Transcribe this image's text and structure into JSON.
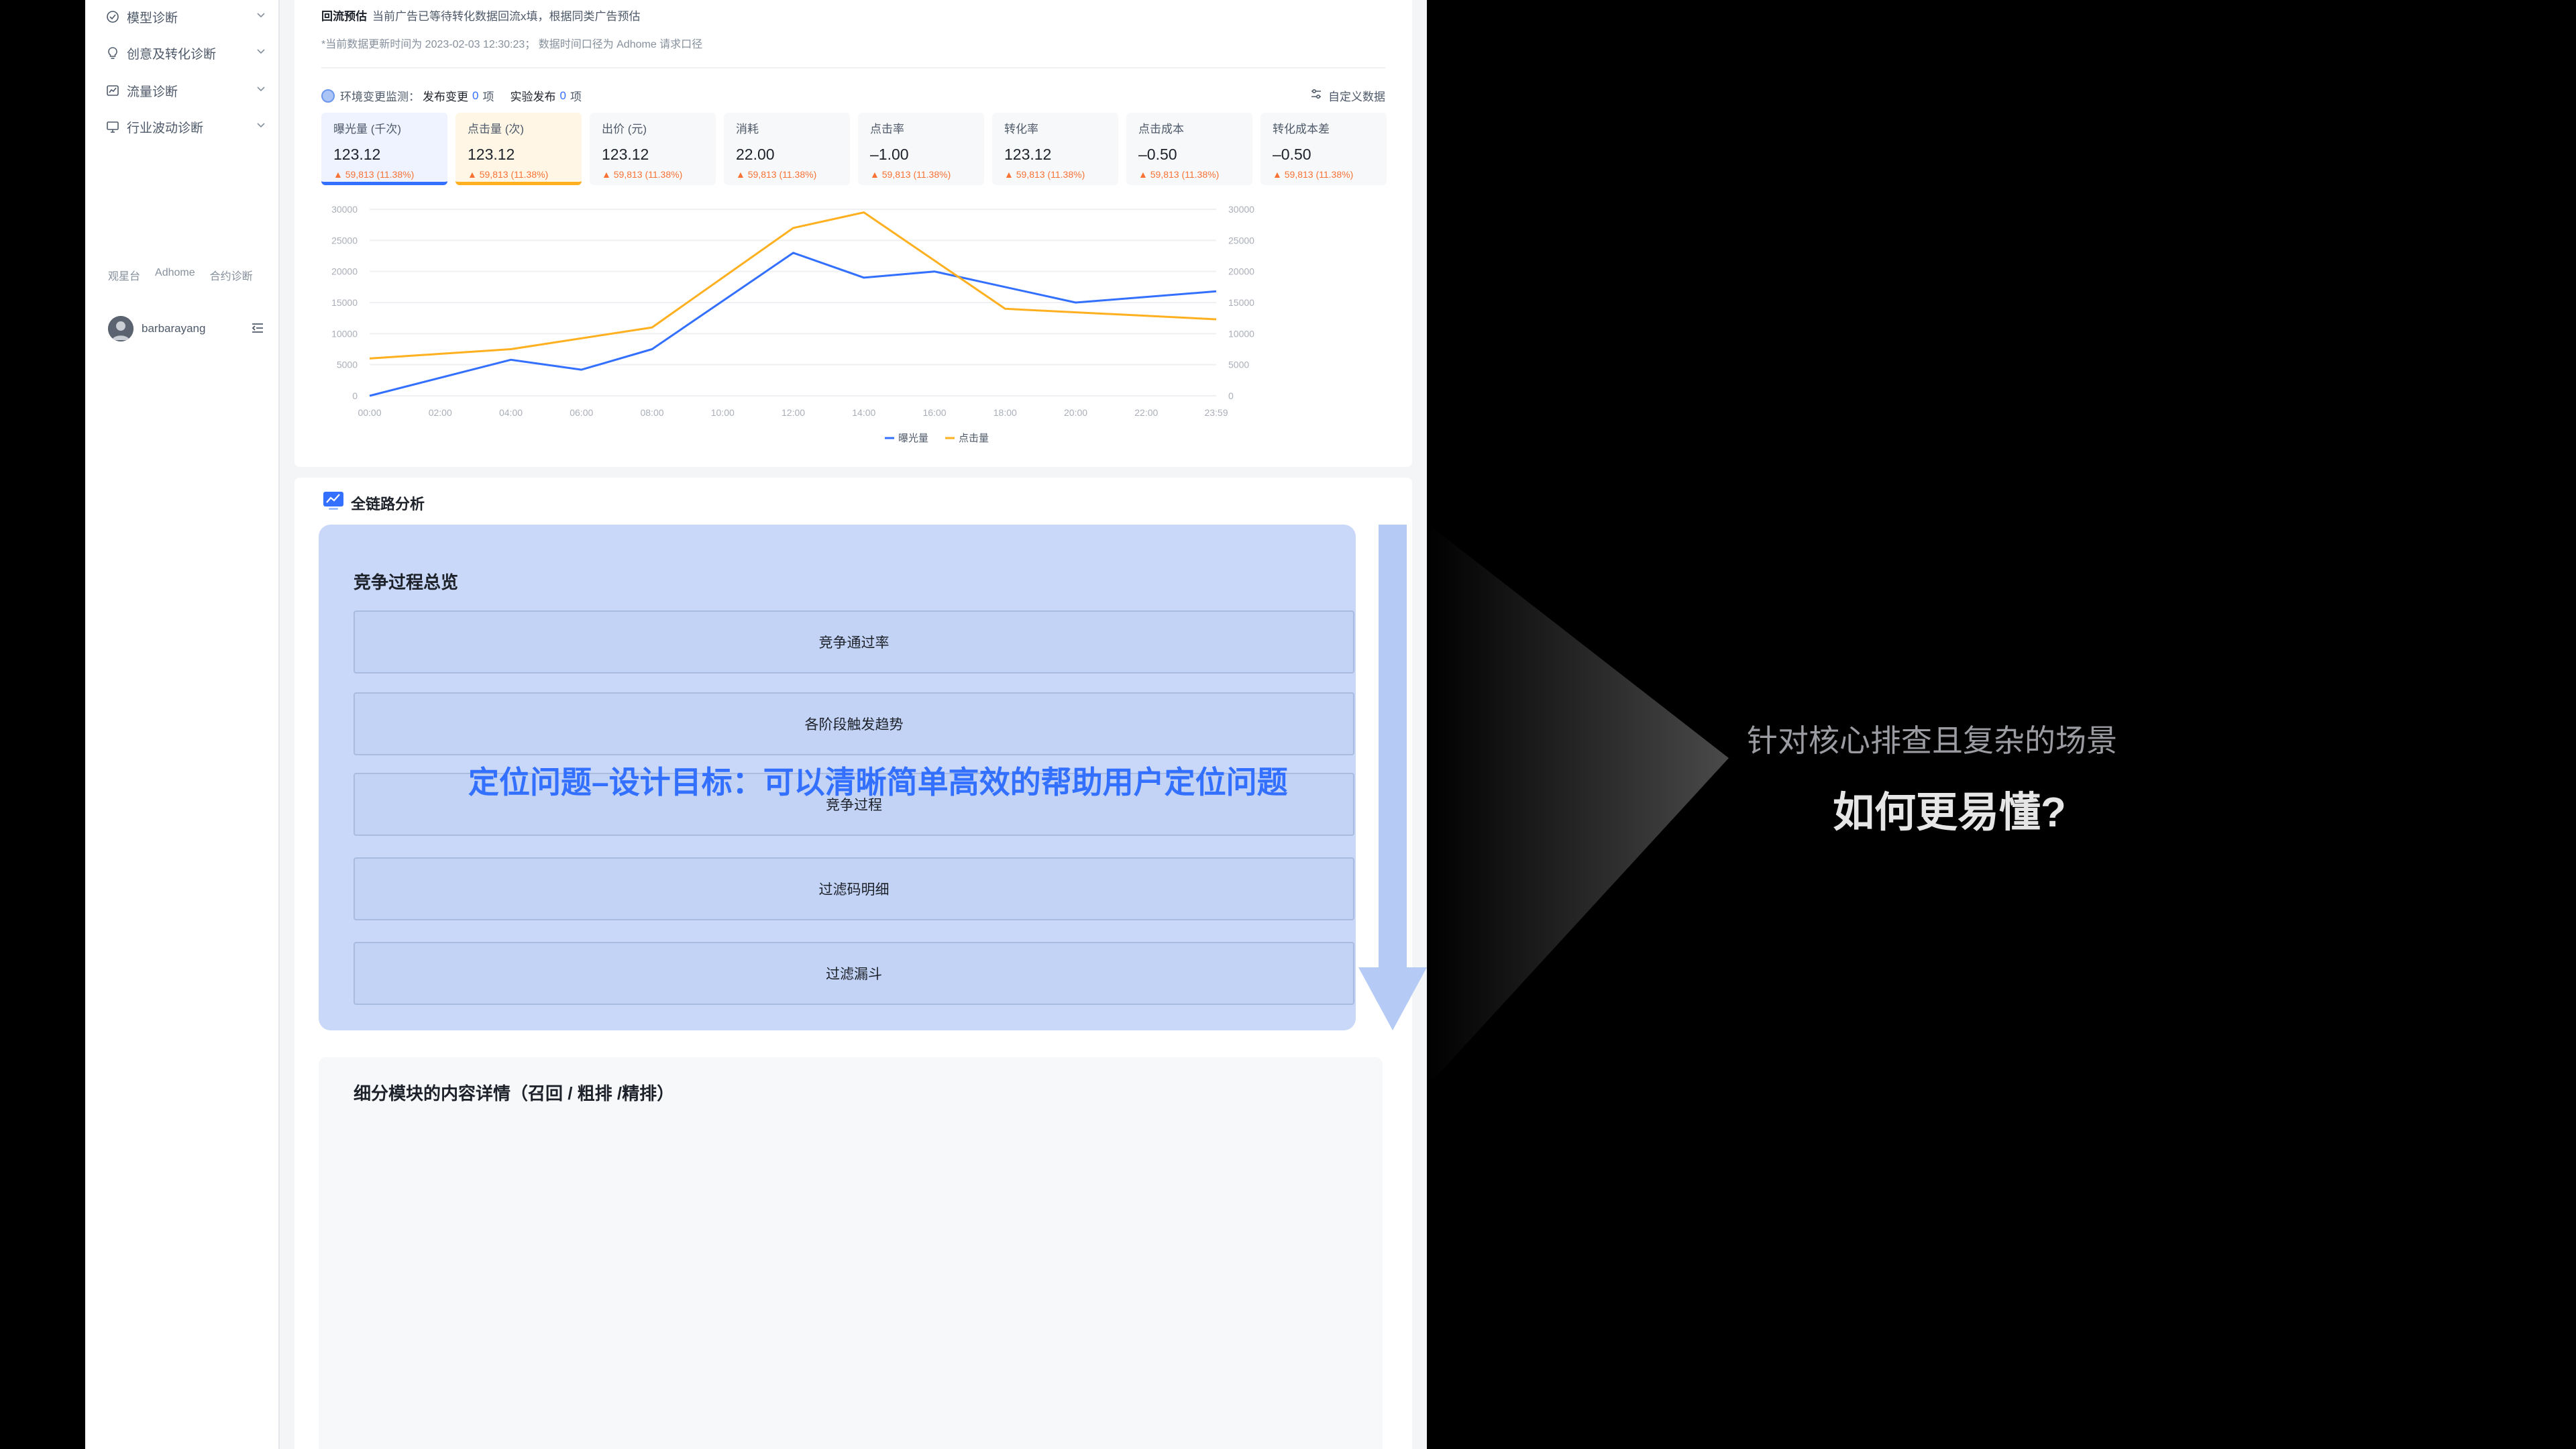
{
  "sidebar": {
    "items": [
      {
        "label": "模型诊断",
        "icon": "model-check-icon"
      },
      {
        "label": "创意及转化诊断",
        "icon": "bulb-icon"
      },
      {
        "label": "流量诊断",
        "icon": "traffic-icon"
      },
      {
        "label": "行业波动诊断",
        "icon": "monitor-icon"
      }
    ],
    "footer_links": [
      "观星台",
      "Adhome",
      "合约诊断"
    ],
    "username": "barbarayang"
  },
  "top_card": {
    "note_title": "回流预估",
    "note_text": "当前广告已等待转化数据回流x填，根据同类广告预估",
    "update_text": "*当前数据更新时间为 2023-02-03 12:30:23； 数据时间口径为 Adhome 请求口径",
    "env_label": "环境变更监测：",
    "publish_label": "发布变更",
    "publish_count": "0",
    "publish_unit": "项",
    "experiment_label": "实验发布",
    "experiment_count": "0",
    "experiment_unit": "项",
    "custom_data": "自定义数据"
  },
  "metrics": [
    {
      "label": "曝光量 (千次)",
      "value": "123.12",
      "change": "59,813 (11.38%)"
    },
    {
      "label": "点击量 (次)",
      "value": "123.12",
      "change": "59,813 (11.38%)"
    },
    {
      "label": "出价 (元)",
      "value": "123.12",
      "change": "59,813 (11.38%)"
    },
    {
      "label": "消耗",
      "value": "22.00",
      "change": "59,813 (11.38%)"
    },
    {
      "label": "点击率",
      "value": "–1.00",
      "change": "59,813 (11.38%)"
    },
    {
      "label": "转化率",
      "value": "123.12",
      "change": "59,813 (11.38%)"
    },
    {
      "label": "点击成本",
      "value": "–0.50",
      "change": "59,813 (11.38%)"
    },
    {
      "label": "转化成本差",
      "value": "–0.50",
      "change": "59,813 (11.38%)"
    }
  ],
  "chart_data": {
    "type": "line",
    "x": [
      "00:00",
      "02:00",
      "04:00",
      "06:00",
      "08:00",
      "10:00",
      "12:00",
      "14:00",
      "16:00",
      "18:00",
      "20:00",
      "22:00",
      "23:59"
    ],
    "ylim": [
      0,
      30000
    ],
    "yticks": [
      "30000",
      "25000",
      "20000",
      "15000",
      "10000",
      "5000",
      "0"
    ],
    "series": [
      {
        "name": "曝光量",
        "color": "#3370ff",
        "points": [
          [
            0,
            0
          ],
          [
            4,
            5800
          ],
          [
            6,
            4200
          ],
          [
            8,
            7500
          ],
          [
            12,
            23000
          ],
          [
            14,
            19000
          ],
          [
            16,
            20000
          ],
          [
            20,
            15000
          ],
          [
            23.98,
            16800
          ]
        ]
      },
      {
        "name": "点击量",
        "color": "#ffb020",
        "points": [
          [
            0,
            6000
          ],
          [
            4,
            7500
          ],
          [
            8,
            11000
          ],
          [
            12,
            27000
          ],
          [
            14,
            29500
          ],
          [
            18,
            14000
          ],
          [
            23.98,
            12300
          ]
        ]
      }
    ],
    "legend": "bottom-center"
  },
  "section": {
    "title": "全链路分析",
    "overview_title": "竞争过程总览",
    "bars": [
      "竞争通过率",
      "各阶段触发趋势",
      "竞争过程",
      "过滤码明细",
      "过滤漏斗"
    ],
    "headline": "定位问题–设计目标：可以清晰简单高效的帮助用户定位问题",
    "detail_title": "细分模块的内容详情（召回 / 粗排 /精排）"
  },
  "right": {
    "subtitle": "针对核心排查且复杂的场景",
    "question": "如何更易懂?"
  }
}
